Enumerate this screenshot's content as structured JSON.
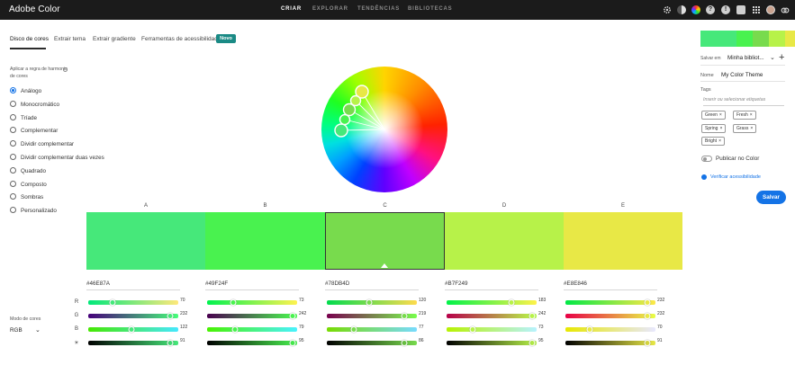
{
  "app": {
    "title": "Adobe Color"
  },
  "nav": [
    {
      "label": "CRIAR",
      "active": true
    },
    {
      "label": "EXPLORAR",
      "active": false
    },
    {
      "label": "TENDÊNCIAS",
      "active": false
    },
    {
      "label": "BIBLIOTECAS",
      "active": false
    }
  ],
  "top_icons": [
    "gear-icon",
    "contrast-icon",
    "color-wheel-icon",
    "help-icon",
    "notifications-icon",
    "messages-icon",
    "grid-apps-icon",
    "avatar",
    "creative-cloud-icon"
  ],
  "tabs": [
    {
      "label": "Disco de cores",
      "active": true
    },
    {
      "label": "Extrair tema",
      "active": false
    },
    {
      "label": "Extrair gradiente",
      "active": false
    },
    {
      "label": "Ferramentas de acessibilidade",
      "active": false
    }
  ],
  "badge": "Novo",
  "rules": {
    "title": "Aplicar a regra de harmonia de cores",
    "items": [
      {
        "label": "Análogo",
        "selected": true
      },
      {
        "label": "Monocromático",
        "selected": false
      },
      {
        "label": "Tríade",
        "selected": false
      },
      {
        "label": "Complementar",
        "selected": false
      },
      {
        "label": "Dividir complementar",
        "selected": false
      },
      {
        "label": "Dividir complementar duas vezes",
        "selected": false
      },
      {
        "label": "Quadrado",
        "selected": false
      },
      {
        "label": "Composto",
        "selected": false
      },
      {
        "label": "Sombras",
        "selected": false
      },
      {
        "label": "Personalizado",
        "selected": false
      }
    ]
  },
  "color_mode": {
    "label": "Modo de cores",
    "value": "RGB"
  },
  "swatches": [
    {
      "label": "A",
      "hex": "#46E87A",
      "r": 70,
      "g": 232,
      "b": 122,
      "bright": 91,
      "selected": false
    },
    {
      "label": "B",
      "hex": "#49F24F",
      "r": 73,
      "g": 242,
      "b": 79,
      "bright": 95,
      "selected": false
    },
    {
      "label": "C",
      "hex": "#78DB4D",
      "r": 120,
      "g": 219,
      "b": 77,
      "bright": 86,
      "selected": true
    },
    {
      "label": "D",
      "hex": "#B7F249",
      "r": 183,
      "g": 242,
      "b": 73,
      "bright": 95,
      "selected": false
    },
    {
      "label": "E",
      "hex": "#E8E846",
      "r": 232,
      "g": 232,
      "b": 70,
      "bright": 91,
      "selected": false
    }
  ],
  "channel_labels": [
    "R",
    "G",
    "B"
  ],
  "brightness_icon": "brightness-icon",
  "panel": {
    "save_in_label": "Salvar em",
    "library": "Minha bibliot...",
    "name_label": "Nome",
    "name_value": "My Color Theme",
    "tags_label": "Tags",
    "tags_placeholder": "Inserir ou selecionar etiquetas",
    "tags": [
      "Green",
      "Fresh",
      "Spring",
      "Grass",
      "Bright"
    ],
    "publish_label": "Publicar no Color",
    "accessibility_link": "Verificar acessibilidade",
    "save_label": "Salvar"
  },
  "colors": {
    "accent": "#1473e6",
    "badge": "#1a8a85",
    "topbar": "#1b1b1b"
  }
}
